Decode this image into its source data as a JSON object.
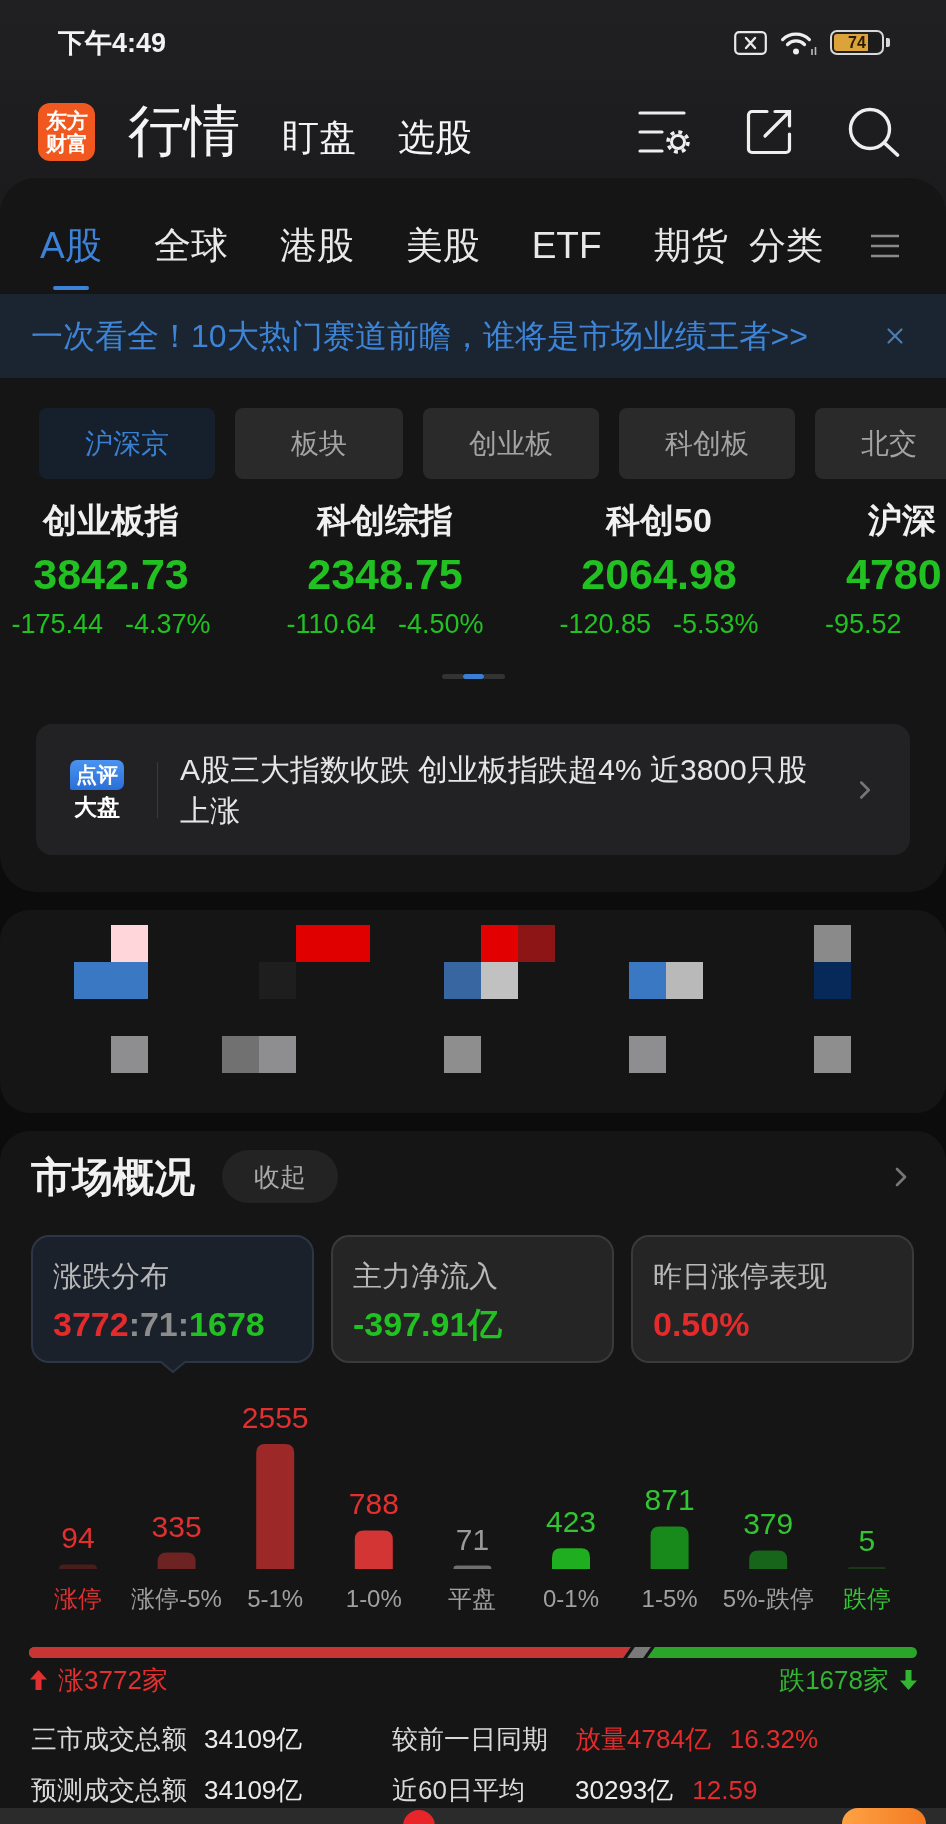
{
  "status_bar": {
    "time": "下午4:49",
    "battery": "74"
  },
  "header": {
    "logo_lines": [
      "东方",
      "财富"
    ],
    "nav": [
      {
        "label": "行情",
        "selected": true
      },
      {
        "label": "盯盘",
        "selected": false
      },
      {
        "label": "选股",
        "selected": false
      }
    ]
  },
  "tabs": [
    {
      "label": "A股",
      "selected": true
    },
    {
      "label": "全球",
      "selected": false
    },
    {
      "label": "港股",
      "selected": false
    },
    {
      "label": "美股",
      "selected": false
    },
    {
      "label": "ETF",
      "selected": false
    },
    {
      "label": "期货",
      "selected": false
    }
  ],
  "category_tab": "分类",
  "banner": {
    "text": "一次看全！10大热门赛道前瞻，谁将是市场业绩王者>>"
  },
  "chips": [
    {
      "label": "沪深京",
      "selected": true
    },
    {
      "label": "板块",
      "selected": false
    },
    {
      "label": "创业板",
      "selected": false
    },
    {
      "label": "科创板",
      "selected": false
    },
    {
      "label": "北交",
      "selected": false
    }
  ],
  "indices": [
    {
      "name": "创业板指",
      "value": "3842.73",
      "change": "-175.44",
      "change_pct": "-4.37%"
    },
    {
      "name": "科创综指",
      "value": "2348.75",
      "change": "-110.64",
      "change_pct": "-4.50%"
    },
    {
      "name": "科创50",
      "value": "2064.98",
      "change": "-120.85",
      "change_pct": "-5.53%"
    },
    {
      "name": "沪深",
      "value": "4780",
      "change": "-95.52"
    }
  ],
  "pager": [
    {
      "selected": false
    },
    {
      "selected": true
    },
    {
      "selected": false
    }
  ],
  "review": {
    "badge_top": "点评",
    "badge_bottom": "大盘",
    "text": "A股三大指数收跌 创业板指跌超4% 近3800只股上涨"
  },
  "market": {
    "title": "市场概况",
    "collapse_button": "收起",
    "cards": [
      {
        "label": "涨跌分布",
        "selected": true,
        "value_parts": [
          {
            "text": "3772",
            "color": "#e42b2b"
          },
          {
            "text": ":71:",
            "color": "#8c8c8c"
          },
          {
            "text": "1678",
            "color": "#22c122"
          }
        ]
      },
      {
        "label": "主力净流入",
        "selected": false,
        "value_parts": [
          {
            "text": "-397.91亿",
            "color": "#22c122"
          }
        ]
      },
      {
        "label": "昨日涨停表现",
        "selected": false,
        "value_parts": [
          {
            "text": "0.50%",
            "color": "#e42b2b"
          }
        ]
      }
    ],
    "chart_data": {
      "type": "bar",
      "categories": [
        "涨停",
        "涨停-5%",
        "5-1%",
        "1-0%",
        "平盘",
        "0-1%",
        "1-5%",
        "5%-跌停",
        "跌停"
      ],
      "series": [
        {
          "values": [
            94,
            335,
            2555,
            788,
            71,
            423,
            871,
            379,
            5
          ]
        }
      ],
      "data_labels": true
    },
    "ratio_bar": {
      "level": 0.68
    },
    "rise_count": "涨3772家",
    "fall_count": "跌1678家",
    "stats": [
      {
        "label": "三市成交总额",
        "value": "34109亿",
        "compare_label": "较前一日同期",
        "compare_parts": [
          {
            "text": "放量4784亿",
            "color": "#e42b2b"
          },
          {
            "text": "16.32%",
            "color": "#e42b2b"
          }
        ]
      },
      {
        "label": "预测成交总额",
        "value": "34109亿",
        "compare_label": "近60日平均",
        "compare_parts": [
          {
            "text": "30293亿",
            "color": "#ececec"
          },
          {
            "text": "12.59",
            "color": "#e42b2b"
          }
        ]
      }
    ]
  }
}
